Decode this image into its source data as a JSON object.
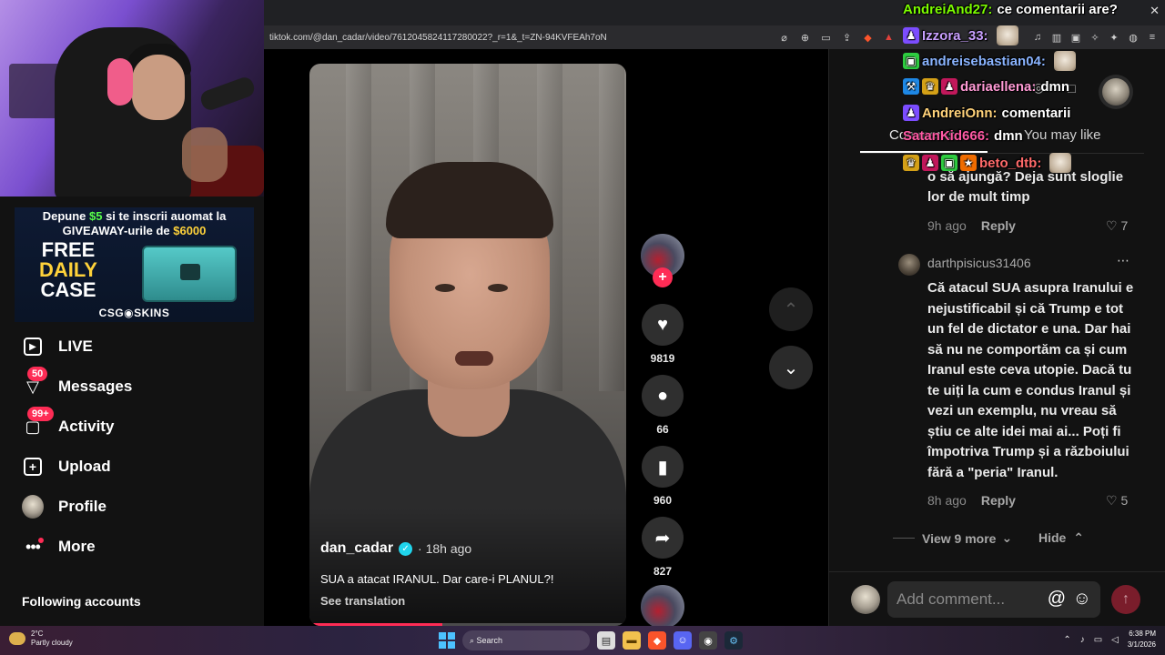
{
  "browser": {
    "url": "tiktok.com/@dan_cadar/video/7612045824117280022?_r=1&_t=ZN-94KVFEAh7oN"
  },
  "stream_ad": {
    "line1_pre": "Depune ",
    "line1_amount": "$5",
    "line1_post": " si te inscrii auomat la",
    "line2_pre": "GIVEAWAY-urile de ",
    "line2_amount": "$6000",
    "free": "FREE",
    "daily": "DAILY",
    "case": "CASE",
    "brand": "CSG◉SKINS"
  },
  "sidebar": {
    "items": [
      {
        "label": "LIVE",
        "icon": "live-icon"
      },
      {
        "label": "Messages",
        "icon": "messages-icon",
        "badge": "50"
      },
      {
        "label": "Activity",
        "icon": "activity-icon",
        "badge": "99+"
      },
      {
        "label": "Upload",
        "icon": "upload-icon"
      },
      {
        "label": "Profile",
        "icon": "profile-avatar"
      },
      {
        "label": "More",
        "icon": "more-icon"
      }
    ],
    "following_label": "Following accounts"
  },
  "video": {
    "author": "dan_cadar",
    "time": "· 18h ago",
    "caption": "SUA a atacat IRANUL. Dar care-i PLANUL?!",
    "translation_label": "See translation",
    "progress": 0.42
  },
  "actions": {
    "likes": "9819",
    "comments": "66",
    "saves": "960",
    "shares": "827"
  },
  "comments_panel": {
    "tab_comments": "Comments",
    "tab_you_may_like": "You may like",
    "comment1": {
      "text_line1": "o să ajungă? Deja sunt sloglie",
      "text_line2": "lor de mult timp",
      "time": "9h ago",
      "reply": "Reply",
      "likes": "7"
    },
    "comment2": {
      "username": "darthpisicus31406",
      "lines": [
        "Că atacul SUA asupra Iranului e",
        "nejustificabil și că Trump e tot",
        "un fel de dictator e una. Dar hai",
        "să nu ne comportăm ca și cum",
        "Iranul este ceva utopie. Dacă tu",
        "te uiți la cum e condus Iranul și",
        "vezi un exemplu, nu vreau să",
        "știu ce alte idei mai ai... Poți fi",
        "împotriva Trump și a războiului",
        "fără a \"peria\" Iranul."
      ],
      "time": "8h ago",
      "reply": "Reply",
      "likes": "5"
    },
    "view_more": "View 9 more",
    "hide": "Hide",
    "add_placeholder": "Add comment..."
  },
  "chat": [
    {
      "user": "AndreiAnd27:",
      "msg": "ce comentarii are?",
      "color": "#7CFC00"
    },
    {
      "user": "Izzora_33:",
      "msg": "",
      "color": "#c9a0ff"
    },
    {
      "user": "andreisebastian04:",
      "msg": "",
      "color": "#8ab4ff"
    },
    {
      "user": "dariaellena:",
      "msg": "dmn",
      "color": "#ff9ad5"
    },
    {
      "user": "AndreiOnn:",
      "msg": "comentarii",
      "color": "#ffd27a"
    },
    {
      "user": "SatanKid666:",
      "msg": "dmn",
      "color": "#ff5aa5"
    },
    {
      "user": "beto_dtb:",
      "msg": "",
      "color": "#ff6a6a"
    }
  ],
  "taskbar": {
    "temp": "2°C",
    "weather": "Partly cloudy",
    "search": "Search",
    "time": "6:38 PM",
    "date": "3/1/2026"
  }
}
